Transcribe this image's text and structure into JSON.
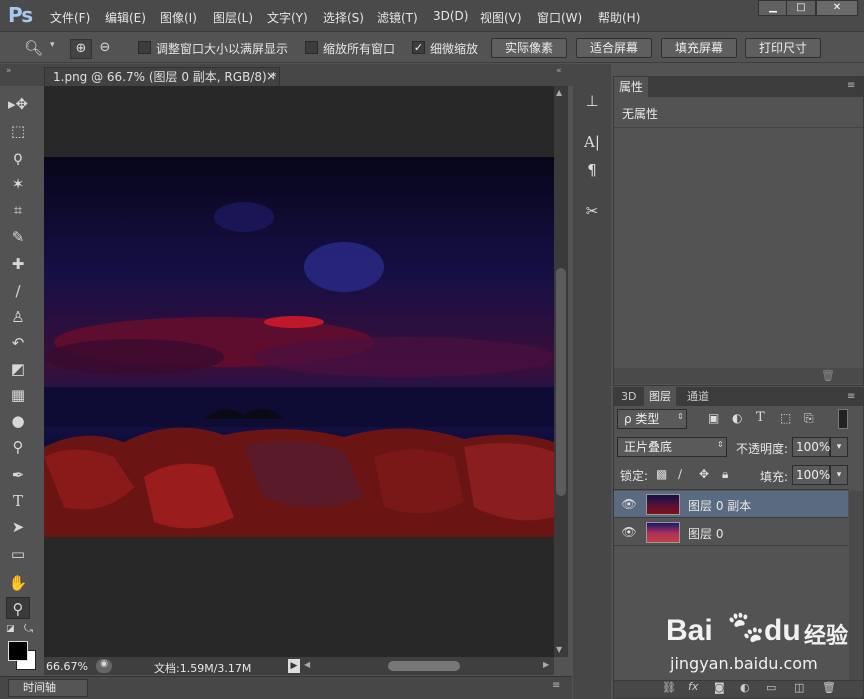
{
  "app": {
    "logo": "Ps"
  },
  "menu": [
    "文件(F)",
    "编辑(E)",
    "图像(I)",
    "图层(L)",
    "文字(Y)",
    "选择(S)",
    "滤镜(T)",
    "3D(D)",
    "视图(V)",
    "窗口(W)",
    "帮助(H)"
  ],
  "window_controls": {
    "minimize": "▁",
    "maximize": "□",
    "close": "✕"
  },
  "options": {
    "checkbox1": {
      "label": "调整窗口大小以满屏显示",
      "checked": false
    },
    "checkbox2": {
      "label": "缩放所有窗口",
      "checked": false
    },
    "checkbox3": {
      "label": "细微缩放",
      "checked": true
    },
    "btn_actual": "实际像素",
    "btn_fit": "适合屏幕",
    "btn_fill": "填充屏幕",
    "btn_print": "打印尺寸"
  },
  "document": {
    "tab": "1.png @ 66.7% (图层 0 副本, RGB/8) *",
    "close": "×"
  },
  "status": {
    "zoom": "66.67%",
    "doc_info": "文档:1.59M/3.17M"
  },
  "timeline": {
    "label": "时间轴"
  },
  "properties": {
    "tab": "属性",
    "content": "无属性"
  },
  "layers": {
    "tabs": [
      "3D",
      "图层",
      "通道"
    ],
    "filter": "ρ 类型",
    "blend_mode": "正片叠底",
    "opacity_label": "不透明度:",
    "opacity_value": "100%",
    "lock_label": "锁定:",
    "fill_label": "填充:",
    "fill_value": "100%",
    "items": [
      {
        "name": "图层 0 副本",
        "selected": true
      },
      {
        "name": "图层 0",
        "selected": false
      }
    ]
  },
  "watermark": {
    "brand": "Bai",
    "brand2": "du",
    "cn": "经验",
    "url": "jingyan.baidu.com"
  },
  "colors": {
    "accent_selected": "#5a6a80",
    "panel_bg": "#535353",
    "canvas_bg": "#282828"
  }
}
